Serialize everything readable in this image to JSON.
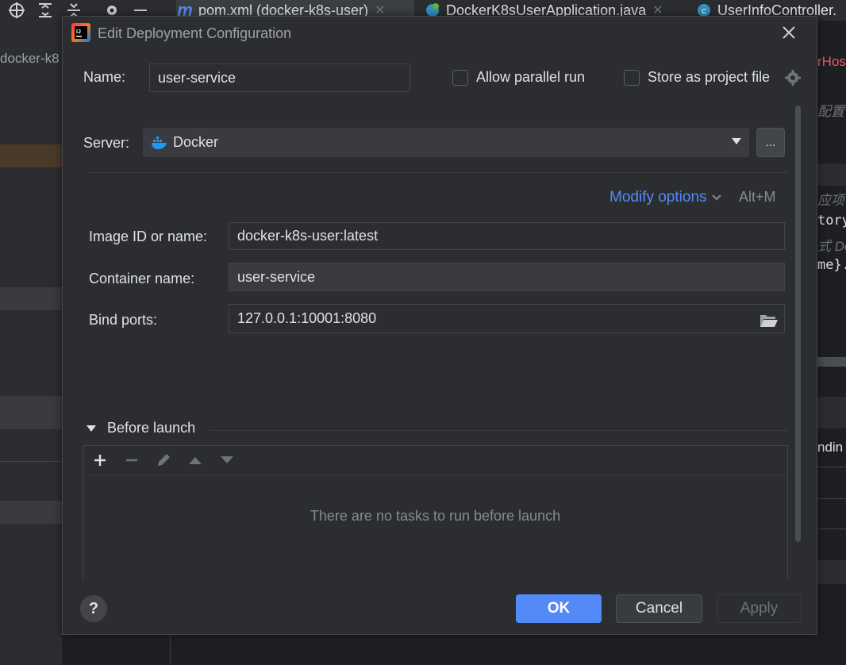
{
  "ide": {
    "tabs": [
      {
        "label": "pom.xml (docker-k8s-user)",
        "icon": "maven-icon"
      },
      {
        "label": "DockerK8sUserApplication.java",
        "icon": "spring-class-icon"
      },
      {
        "label": "UserInfoController.",
        "icon": "class-icon"
      }
    ],
    "project_label": "docker-k8",
    "right_fragments": [
      "rHos",
      "配置",
      "应项",
      "tory",
      "式 Do",
      "me}.",
      "ndin"
    ]
  },
  "dialog": {
    "title": "Edit Deployment Configuration",
    "name_label": "Name:",
    "name_value": "user-service",
    "allow_parallel_label": "Allow parallel run",
    "store_project_label": "Store as project file",
    "server_label": "Server:",
    "server_value": "Docker",
    "dots_label": "...",
    "modify_options_label": "Modify options",
    "modify_shortcut": "Alt+M",
    "image_label": "Image ID or name:",
    "image_value": "docker-k8s-user:latest",
    "container_label": "Container name:",
    "container_value": "user-service",
    "ports_label": "Bind ports:",
    "ports_value": "127.0.0.1:10001:8080",
    "before_launch_label": "Before launch",
    "empty_tasks": "There are no tasks to run before launch",
    "help_label": "?",
    "ok_label": "OK",
    "cancel_label": "Cancel",
    "apply_label": "Apply"
  },
  "colors": {
    "accent": "#548af7",
    "dialog_bg": "#2b2d30",
    "error_red": "#f75464",
    "docker_blue": "#2496ed"
  }
}
